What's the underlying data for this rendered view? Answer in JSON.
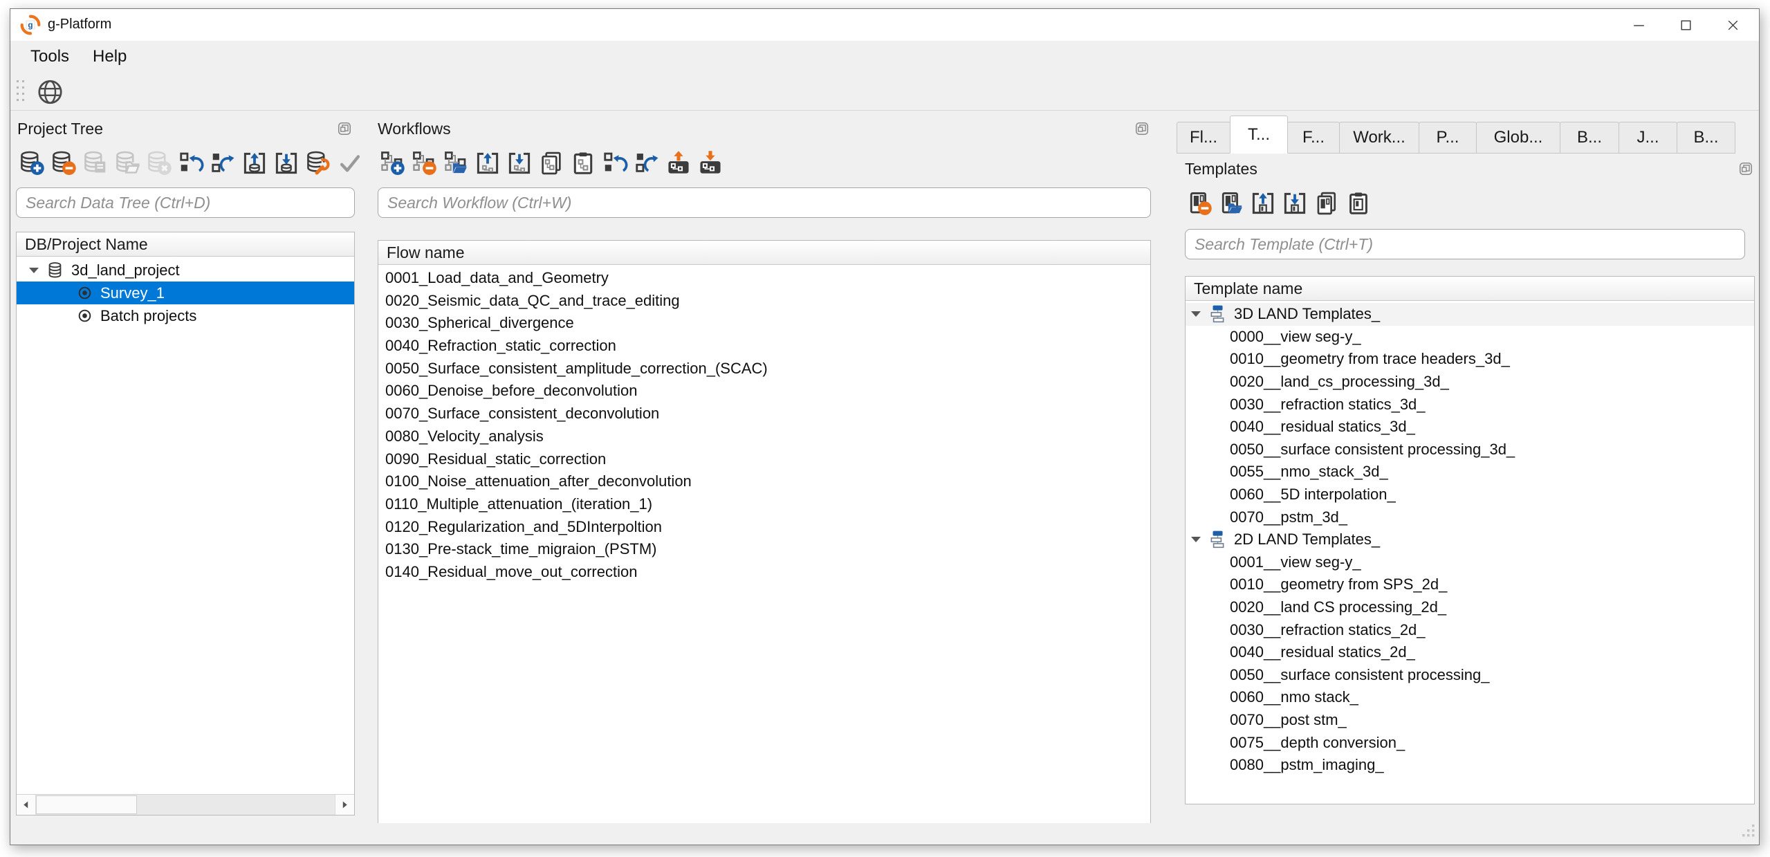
{
  "window": {
    "title": "g-Platform",
    "controls": [
      "minimize",
      "maximize",
      "close"
    ]
  },
  "menu": {
    "items": [
      "Tools",
      "Help"
    ]
  },
  "main_toolbar": {
    "icons": [
      {
        "name": "globe-icon",
        "enabled": true
      }
    ]
  },
  "project_tree_panel": {
    "title": "Project Tree",
    "search_placeholder": "Search Data Tree (Ctrl+D)",
    "column_header": "DB/Project Name",
    "toolbar": [
      {
        "name": "add-database-icon",
        "enabled": true
      },
      {
        "name": "remove-database-icon",
        "enabled": true
      },
      {
        "name": "copy-database-icon",
        "enabled": false
      },
      {
        "name": "open-database-icon",
        "enabled": false
      },
      {
        "name": "close-database-icon",
        "enabled": false
      },
      {
        "name": "undo-icon",
        "enabled": true
      },
      {
        "name": "redo-icon",
        "enabled": true
      },
      {
        "name": "export-database-icon",
        "enabled": true
      },
      {
        "name": "import-database-icon",
        "enabled": true
      },
      {
        "name": "database-tools-icon",
        "enabled": true
      },
      {
        "name": "apply-check-icon",
        "enabled": true
      }
    ],
    "tree": [
      {
        "label": "3d_land_project",
        "icon": "database-icon",
        "expanded": true,
        "level": 0,
        "selected": false
      },
      {
        "label": "Survey_1",
        "icon": "survey-icon",
        "level": 1,
        "selected": true
      },
      {
        "label": "Batch projects",
        "icon": "survey-icon",
        "level": 1,
        "selected": false
      }
    ]
  },
  "workflows_panel": {
    "title": "Workflows",
    "search_placeholder": "Search Workflow (Ctrl+W)",
    "column_header": "Flow name",
    "toolbar": [
      {
        "name": "add-workflow-icon",
        "enabled": true
      },
      {
        "name": "remove-workflow-icon",
        "enabled": true
      },
      {
        "name": "open-workflow-icon",
        "enabled": true
      },
      {
        "name": "export-workflow-icon",
        "enabled": true
      },
      {
        "name": "import-workflow-icon",
        "enabled": true
      },
      {
        "name": "copy-workflow-icon",
        "enabled": true
      },
      {
        "name": "paste-workflow-icon",
        "enabled": true
      },
      {
        "name": "undo-icon",
        "enabled": true
      },
      {
        "name": "redo-icon",
        "enabled": true
      },
      {
        "name": "upload-workflow-icon",
        "enabled": true
      },
      {
        "name": "download-workflow-icon",
        "enabled": true
      }
    ],
    "flows": [
      "0001_Load_data_and_Geometry",
      "0020_Seismic_data_QC_and_trace_editing",
      "0030_Spherical_divergence",
      "0040_Refraction_static_correction",
      "0050_Surface_consistent_amplitude_correction_(SCAC)",
      "0060_Denoise_before_deconvolution",
      "0070_Surface_consistent_deconvolution",
      "0080_Velocity_analysis",
      "0090_Residual_static_correction",
      "0100_Noise_attenuation_after_deconvolution",
      "0110_Multiple_attenuation_(iteration_1)",
      "0120_Regularization_and_5DInterpoltion",
      "0130_Pre-stack_time_migraion_(PSTM)",
      "0140_Residual_move_out_correction"
    ]
  },
  "right_panel": {
    "tabs": [
      {
        "label": "Fl...",
        "active": false
      },
      {
        "label": "T...",
        "active": true
      },
      {
        "label": "F...",
        "active": false
      },
      {
        "label": "Work...",
        "active": false
      },
      {
        "label": "P...",
        "active": false
      },
      {
        "label": "Glob...",
        "active": false
      },
      {
        "label": "B...",
        "active": false
      },
      {
        "label": "J...",
        "active": false
      },
      {
        "label": "B...",
        "active": false
      }
    ],
    "templates": {
      "title": "Templates",
      "search_placeholder": "Search Template (Ctrl+T)",
      "column_header": "Template name",
      "toolbar": [
        {
          "name": "remove-template-icon",
          "enabled": true
        },
        {
          "name": "open-template-icon",
          "enabled": true
        },
        {
          "name": "export-template-icon",
          "enabled": true
        },
        {
          "name": "import-template-icon",
          "enabled": true
        },
        {
          "name": "copy-template-icon",
          "enabled": true
        },
        {
          "name": "paste-template-icon",
          "enabled": true
        }
      ],
      "groups": [
        {
          "label": "3D LAND Templates_",
          "icon": "template-group-icon",
          "expanded": true,
          "highlighted": true,
          "items": [
            "0000__view seg-y_",
            "0010__geometry from trace headers_3d_",
            "0020__land_cs_processing_3d_",
            "0030__refraction statics_3d_",
            "0040__residual statics_3d_",
            "0050__surface consistent processing_3d_",
            "0055__nmo_stack_3d_",
            "0060__5D interpolation_",
            "0070__pstm_3d_"
          ]
        },
        {
          "label": "2D LAND Templates_",
          "icon": "template-group-icon",
          "expanded": true,
          "highlighted": false,
          "items": [
            "0001__view seg-y_",
            "0010__geometry from SPS_2d_",
            "0020__land CS processing_2d_",
            "0030__refraction statics_2d_",
            "0040__residual statics_2d_",
            "0050__surface consistent processing_",
            "0060__nmo stack_",
            "0070__post stm_",
            "0075__depth conversion_",
            "0080__pstm_imaging_"
          ]
        }
      ]
    }
  },
  "colors": {
    "selection": "#0078d7",
    "accent_blue": "#1e5fa8",
    "accent_orange": "#e8701a",
    "panel_bg": "#f0f0f0"
  }
}
